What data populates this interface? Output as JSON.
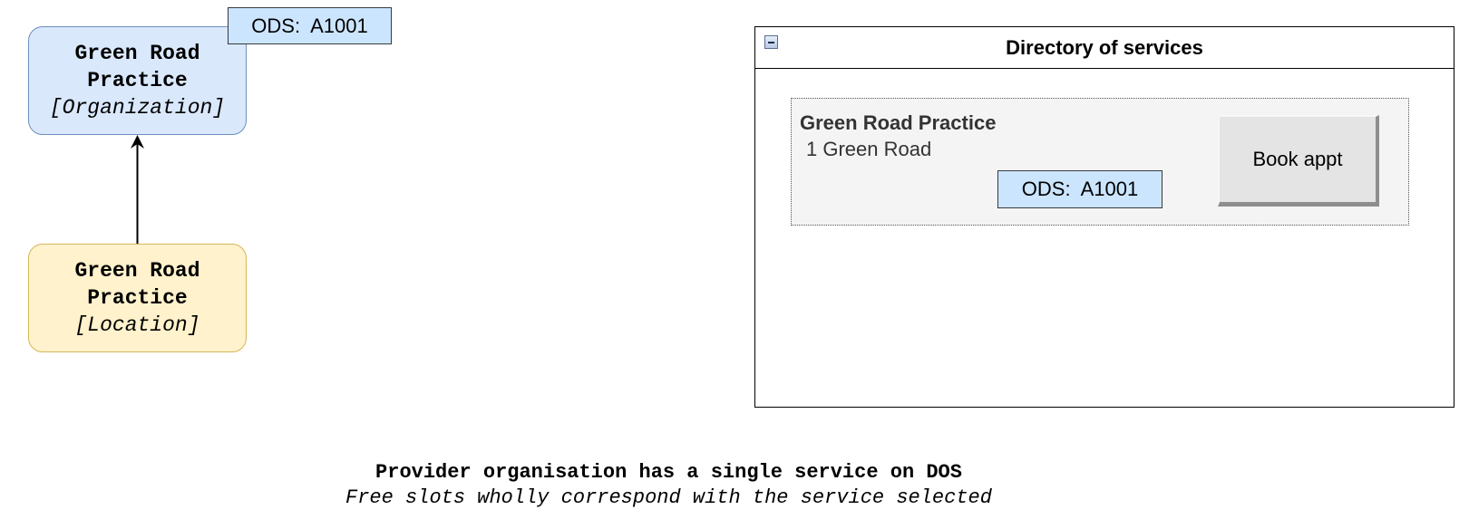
{
  "organization_node": {
    "name_line1": "Green Road",
    "name_line2": "Practice",
    "stereotype": "[Organization]",
    "fill": "#dae8fc",
    "stroke": "#6c8ebf",
    "ods_label": "ODS:  A1001"
  },
  "location_node": {
    "name_line1": "Green Road",
    "name_line2": "Practice",
    "stereotype": "[Location]",
    "fill": "#fff2cc",
    "stroke": "#d6b656"
  },
  "directory": {
    "title": "Directory of services",
    "collapse_icon": "collapse-minus-icon",
    "service": {
      "name": "Green Road Practice",
      "address": "1 Green Road",
      "ods_label": "ODS:  A1001",
      "button_label": "Book appt"
    }
  },
  "caption": {
    "title": "Provider organisation has a single service on DOS",
    "subtitle": "Free slots wholly correspond with the service selected"
  },
  "colors": {
    "ods_tag_fill": "#cce5ff",
    "card_fill": "#f4f4f4",
    "button_fill": "#e4e4e4"
  }
}
